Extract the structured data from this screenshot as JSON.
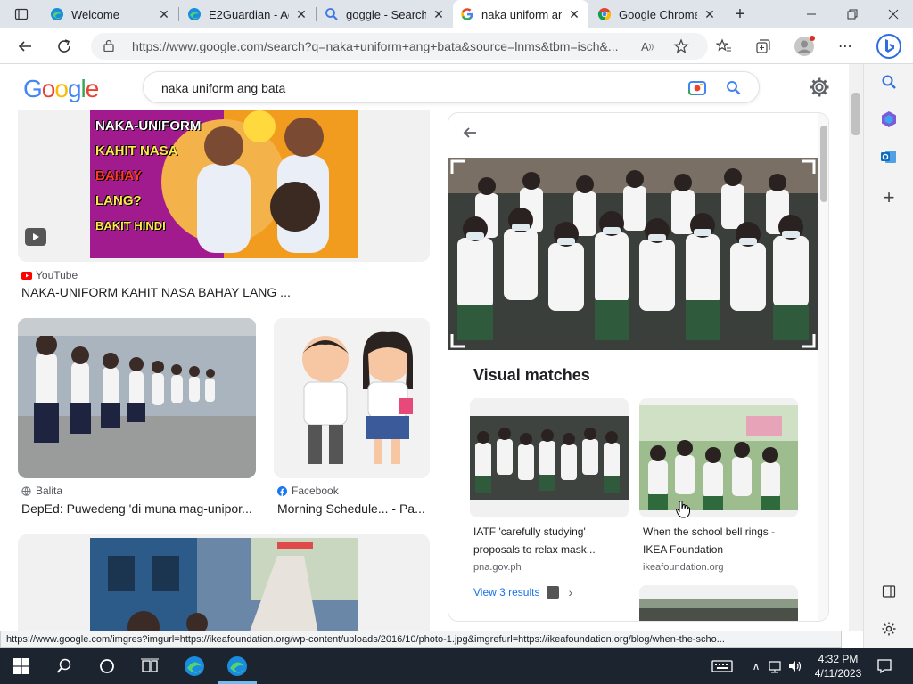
{
  "tabs": [
    {
      "title": "Welcome",
      "icon": "edge-icon"
    },
    {
      "title": "E2Guardian - Ac",
      "icon": "edge-icon"
    },
    {
      "title": "goggle - Search",
      "icon": "search-icon"
    },
    {
      "title": "naka uniform an",
      "icon": "google-icon"
    },
    {
      "title": "Google Chrome",
      "icon": "chrome-icon"
    }
  ],
  "url": "https://www.google.com/search?q=naka+uniform+ang+bata&source=lnms&tbm=isch&...",
  "search": {
    "query": "naka uniform ang bata",
    "logo": "Google"
  },
  "results": [
    {
      "source": "YouTube",
      "caption": "NAKA-UNIFORM KAHIT NASA BAHAY LANG ...",
      "thumb_text": [
        "NAKA-UNIFORM",
        "KAHIT NASA",
        "BAHAY",
        "LANG?",
        "BAKIT HINDI"
      ]
    },
    {
      "source": "Balita",
      "caption": "DepEd: Puwedeng 'di muna mag-unipor..."
    },
    {
      "source": "Facebook",
      "caption": "Morning Schedule... - Pa..."
    }
  ],
  "preview": {
    "visual_matches_title": "Visual matches",
    "matches": [
      {
        "title": "IATF 'carefully studying' proposals to relax mask...",
        "source": "pna.gov.ph"
      },
      {
        "title": "When the school bell rings - IKEA Foundation",
        "source": "ikeafoundation.org"
      }
    ],
    "view_results": "View 3 results"
  },
  "status_url": "https://www.google.com/imgres?imgurl=https://ikeafoundation.org/wp-content/uploads/2016/10/photo-1.jpg&imgrefurl=https://ikeafoundation.org/blog/when-the-scho...",
  "clock": {
    "time": "4:32 PM",
    "date": "4/11/2023"
  },
  "colors": {
    "google_blue": "#4285f4",
    "google_red": "#ea4335",
    "google_yellow": "#fbbc05",
    "google_green": "#34a853",
    "link_blue": "#1a73e8"
  }
}
